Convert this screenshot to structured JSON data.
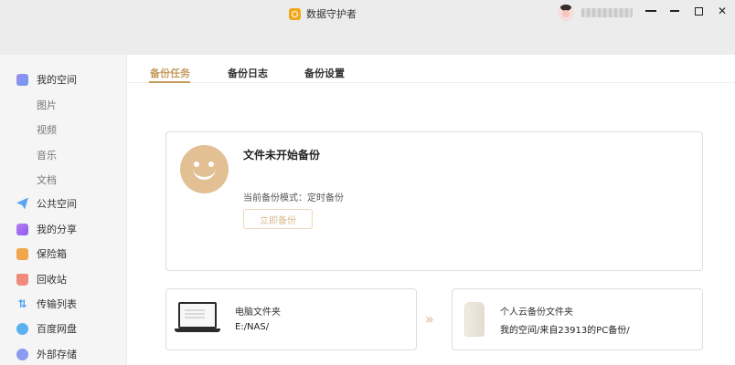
{
  "app": {
    "title": "数据守护者"
  },
  "window": {
    "controls": [
      "menu-icon",
      "minimize-icon",
      "maximize-icon",
      "close-icon"
    ]
  },
  "sidebar": {
    "items": [
      {
        "label": "我的空间",
        "icon": "my-space-icon"
      },
      {
        "label": "图片"
      },
      {
        "label": "视频"
      },
      {
        "label": "音乐"
      },
      {
        "label": "文档"
      },
      {
        "label": "公共空间",
        "icon": "public-space-icon"
      },
      {
        "label": "我的分享",
        "icon": "share-icon"
      },
      {
        "label": "保险箱",
        "icon": "safe-icon"
      },
      {
        "label": "回收站",
        "icon": "recycle-bin-icon"
      },
      {
        "label": "传输列表",
        "icon": "transfer-icon"
      },
      {
        "label": "百度网盘",
        "icon": "baidu-netdisk-icon"
      },
      {
        "label": "外部存储",
        "icon": "external-storage-icon"
      }
    ]
  },
  "tabs": [
    {
      "label": "备份任务",
      "active": true
    },
    {
      "label": "备份日志",
      "active": false
    },
    {
      "label": "备份设置",
      "active": false
    }
  ],
  "status": {
    "title": "文件未开始备份",
    "mode": "当前备份模式：定时备份",
    "button": "立即备份"
  },
  "source": {
    "label": "电脑文件夹",
    "path": "E:/NAS/"
  },
  "destination": {
    "label": "个人云备份文件夹",
    "path": "我的空间/来自23913的PC备份/"
  },
  "colors": {
    "accent": "#c79a5e",
    "smiley": "#e2c094",
    "sidebar_bg": "#f5f5f5",
    "titlebar_bg": "#ececec"
  }
}
